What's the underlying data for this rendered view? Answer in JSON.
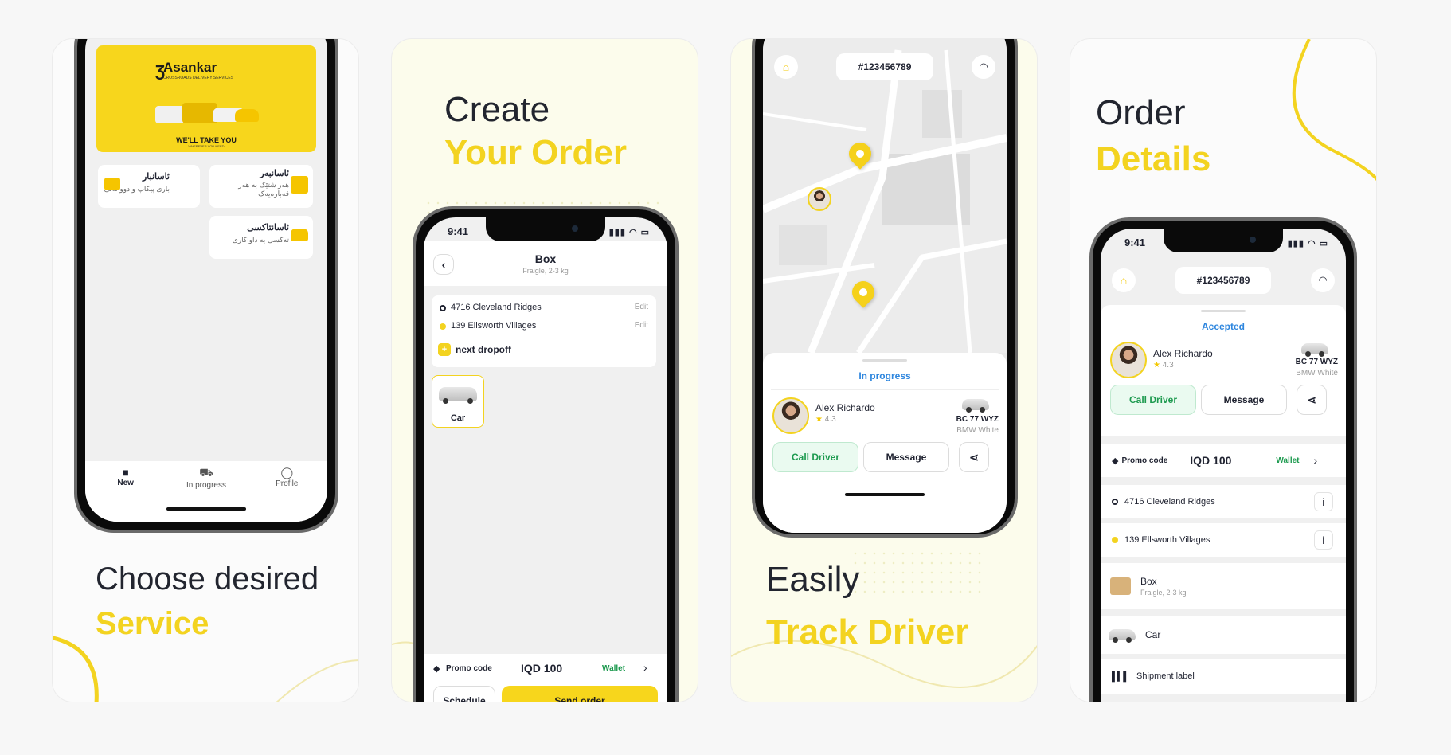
{
  "panel1": {
    "caption_line1": "Choose desired",
    "caption_line2": "Service",
    "banner": {
      "brand": "Asankar",
      "tagline": "CROSSROADS DELIVERY SERVICES",
      "slogan": "WE'LL TAKE YOU",
      "slogan_sub": "WHEREVER YOU NEED"
    },
    "services": [
      {
        "title": "ئاسانبار",
        "desc": "باری پیکاپ و دوو تەنی"
      },
      {
        "title": "ئاسانبەر",
        "desc": "هەر شتێک بە هەر قەبارەیەک"
      },
      {
        "title": "ئاسانتاکسی",
        "desc": "تەکسی بە داواکاری"
      }
    ],
    "nav": [
      {
        "label": "New"
      },
      {
        "label": "In progress"
      },
      {
        "label": "Profile"
      }
    ]
  },
  "panel2": {
    "caption_line1": "Create",
    "caption_line2": "Your Order",
    "status_time": "9:41",
    "title": "Box",
    "subtitle": "Fraigle, 2-3 kg",
    "addresses": [
      {
        "text": "4716 Cleveland Ridges",
        "action": "Edit"
      },
      {
        "text": "139 Ellsworth Villages",
        "action": "Edit"
      }
    ],
    "next_dropoff": "next dropoff",
    "vehicle_label": "Car",
    "promo_label": "Promo code",
    "amount": "IQD 100",
    "wallet": "Wallet",
    "schedule": "Schedule",
    "send_order": "Send order"
  },
  "panel3": {
    "caption_line1": "Easily",
    "caption_line2": "Track Driver",
    "order_id": "#123456789",
    "status": "In progress",
    "driver_name": "Alex Richardo",
    "rating": "4.3",
    "plate": "BC 77 WYZ",
    "car_desc": "BMW White",
    "call": "Call Driver",
    "message": "Message"
  },
  "panel4": {
    "caption_line1": "Order",
    "caption_line2": "Details",
    "status_time": "9:41",
    "order_id": "#123456789",
    "status": "Accepted",
    "driver_name": "Alex Richardo",
    "rating": "4.3",
    "plate": "BC 77 WYZ",
    "car_desc": "BMW White",
    "call": "Call Driver",
    "message": "Message",
    "promo_label": "Promo code",
    "amount": "IQD 100",
    "wallet": "Wallet",
    "addresses": [
      "4716 Cleveland Ridges",
      "139 Ellsworth Villages"
    ],
    "item_title": "Box",
    "item_sub": "Fraigle, 2-3 kg",
    "vehicle": "Car",
    "shipment_label": "Shipment label"
  },
  "colors": {
    "accent": "#f3d320",
    "green": "#1d9a4f",
    "blue": "#2e86de",
    "dark": "#22252f"
  }
}
